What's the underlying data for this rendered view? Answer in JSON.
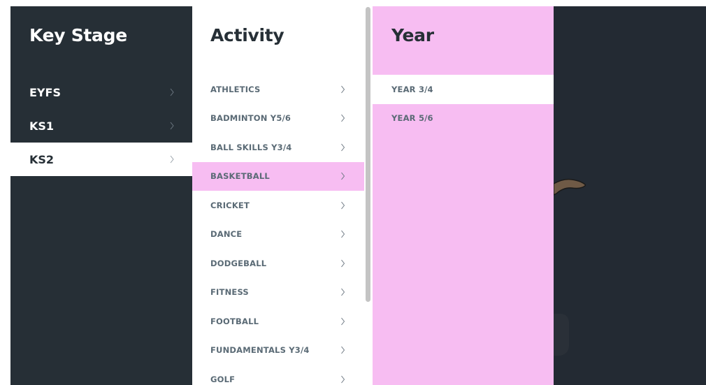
{
  "key_stage": {
    "title": "Key Stage",
    "items": [
      {
        "label": "EYFS",
        "selected": false
      },
      {
        "label": "KS1",
        "selected": false
      },
      {
        "label": "KS2",
        "selected": true
      }
    ]
  },
  "activity": {
    "title": "Activity",
    "items": [
      {
        "label": "ATHLETICS",
        "selected": false
      },
      {
        "label": "BADMINTON Y5/6",
        "selected": false
      },
      {
        "label": "BALL SKILLS Y3/4",
        "selected": false
      },
      {
        "label": "BASKETBALL",
        "selected": true
      },
      {
        "label": "CRICKET",
        "selected": false
      },
      {
        "label": "DANCE",
        "selected": false
      },
      {
        "label": "DODGEBALL",
        "selected": false
      },
      {
        "label": "FITNESS",
        "selected": false
      },
      {
        "label": "FOOTBALL",
        "selected": false
      },
      {
        "label": "FUNDAMENTALS Y3/4",
        "selected": false
      },
      {
        "label": "GOLF",
        "selected": false
      }
    ]
  },
  "year": {
    "title": "Year",
    "items": [
      {
        "label": "YEAR 3/4",
        "selected": true
      },
      {
        "label": "YEAR 5/6",
        "selected": false
      }
    ]
  },
  "colors": {
    "dark_panel": "#262f36",
    "highlight_pink": "#f7bdf2",
    "item_text": "#5a6a75",
    "background": "#232a33"
  },
  "icons": {
    "item_chevron": "chevron-right-icon"
  }
}
